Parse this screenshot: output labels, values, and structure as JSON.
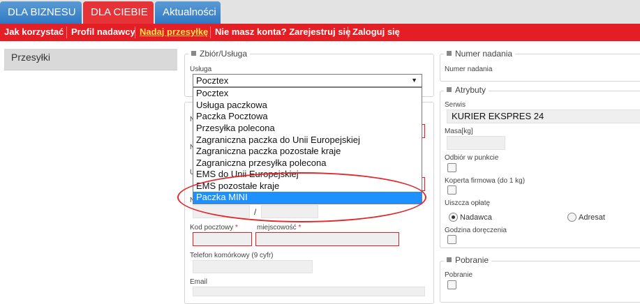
{
  "tabs": [
    {
      "label": "DLA BIZNESU"
    },
    {
      "label": "DLA CIEBIE"
    },
    {
      "label": "Aktualności"
    }
  ],
  "nav": [
    {
      "label": "Jak korzystać"
    },
    {
      "label": "Profil nadawcy"
    },
    {
      "label": "Nadaj przesyłkę"
    },
    {
      "label": "Nie masz konta? Zarejestruj się"
    },
    {
      "label": "Zaloguj się"
    }
  ],
  "sidebar": {
    "item": "Przesyłki"
  },
  "zbior": {
    "legend": "Zbiór/Usługa",
    "usluga_label": "Usługa",
    "selected": "Pocztex",
    "options": [
      "Pocztex",
      "Usługa paczkowa",
      "Paczka Pocztowa",
      "Przesyłka polecona",
      "Zagraniczna paczka do Unii Europejskiej",
      "Zagraniczna paczka pozostałe kraje",
      "Zagraniczna przesyłka polecona",
      "EMS do Unii Europejskiej",
      "EMS pozostałe kraje",
      "Paczka MINI"
    ],
    "highlighted_option": "Paczka MINI"
  },
  "address": {
    "slash": "/",
    "kod_label": "Kod pocztowy",
    "miejsc_label": "miejscowość",
    "required_mark": "*",
    "telefon_label": "Telefon komórkowy (9 cyfr)",
    "email_label": "Email",
    "cut_labels": [
      "N",
      "N",
      "U",
      "N"
    ]
  },
  "numer": {
    "legend": "Numer nadania",
    "label": "Numer nadania"
  },
  "atrybuty": {
    "legend": "Atrybuty",
    "serwis_label": "Serwis",
    "serwis_value": "KURIER EKSPRES 24",
    "masa_label": "Masa[kg]",
    "odbior_label": "Odbiór w punkcie",
    "koperta_label": "Koperta firmowa (do 1 kg)",
    "uiszcza_label": "Uiszcza opłatę",
    "radio_nadawca": "Nadawca",
    "radio_adresat": "Adresat",
    "godzina_label": "Godzina doręczenia"
  },
  "pobranie": {
    "legend": "Pobranie",
    "label": "Pobranie"
  }
}
